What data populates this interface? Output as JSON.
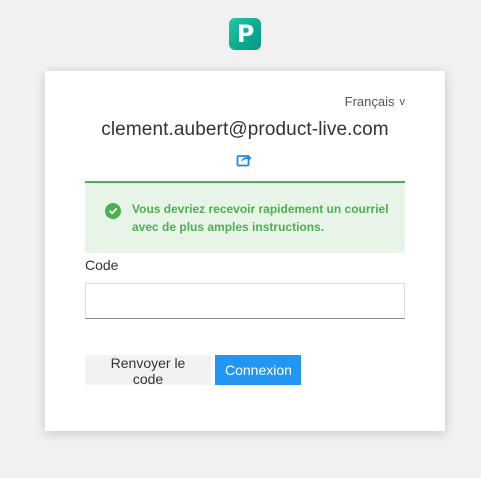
{
  "app": {
    "logo_letter": "P",
    "brand_color": "#0aa890"
  },
  "header": {
    "language_label": "Français",
    "language_chevron": "v"
  },
  "account": {
    "email": "clement.aubert@product-live.com",
    "edit_icon": "share-edit-icon"
  },
  "alert": {
    "type": "success",
    "icon": "check-circle-icon",
    "line1": "Vous devriez recevoir rapidement un courriel",
    "line2": "avec de plus amples instructions.",
    "color": "#4caf50"
  },
  "form": {
    "code_label": "Code",
    "code_value": "",
    "code_placeholder": ""
  },
  "actions": {
    "resend_label": "Renvoyer le code",
    "connect_label": "Connexion",
    "accent_color": "#2196f3"
  }
}
